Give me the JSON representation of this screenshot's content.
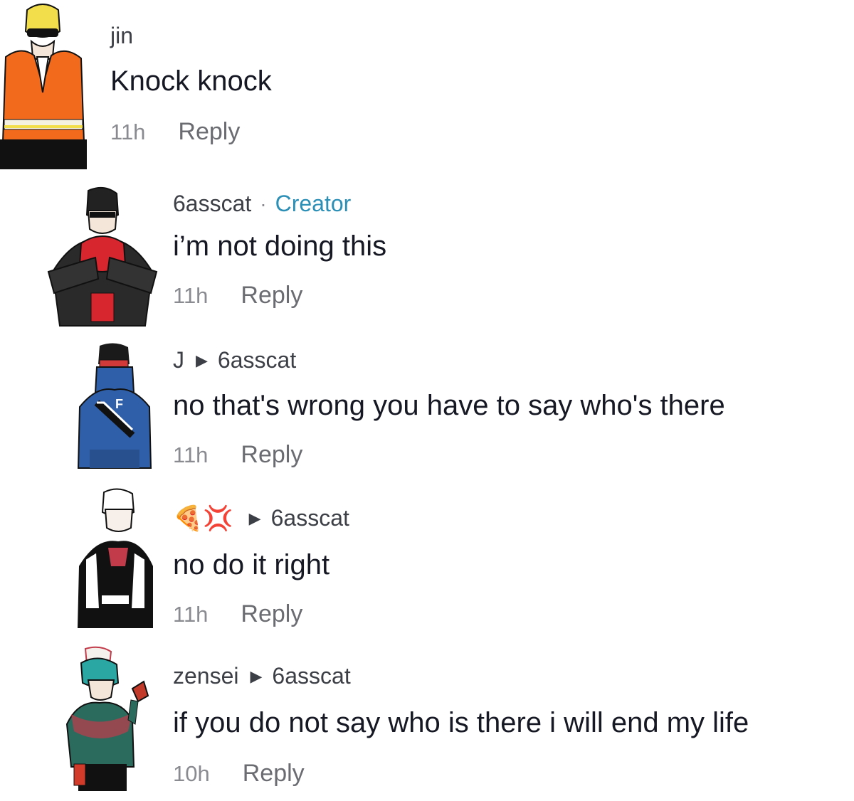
{
  "comments": [
    {
      "username": "jin",
      "text": "Knock knock",
      "time": "11h",
      "reply": "Reply"
    },
    {
      "username": "6asscat",
      "badge": "Creator",
      "text": "i’m not doing this",
      "time": "11h",
      "reply": "Reply"
    },
    {
      "username": "J",
      "reply_to": "6asscat",
      "text": "no that's wrong you have to say who's there",
      "time": "11h",
      "reply": "Reply"
    },
    {
      "username_emoji": "🍕💢",
      "reply_to": "6asscat",
      "text": "no do it right",
      "time": "11h",
      "reply": "Reply"
    },
    {
      "username": "zensei",
      "reply_to": "6asscat",
      "text": "if you do not say who is there i will end my life",
      "time": "10h",
      "reply": "Reply"
    }
  ],
  "colors": {
    "creator": "#2b8fb6",
    "text": "#161823",
    "meta": "#8a8b91"
  },
  "icons": {
    "reply_arrow": "triangle-right-icon"
  }
}
